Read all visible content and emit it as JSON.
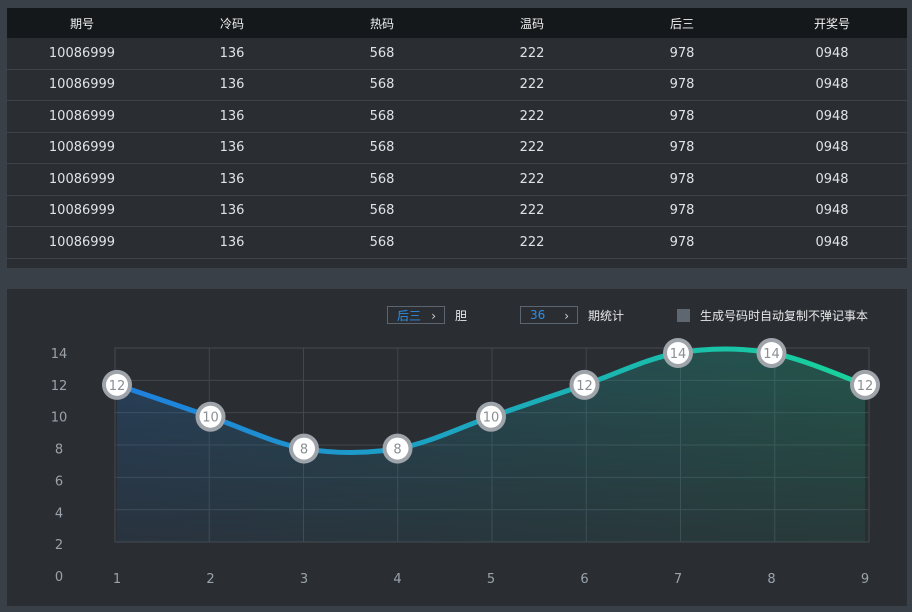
{
  "table": {
    "headers": [
      "期号",
      "冷码",
      "热码",
      "温码",
      "后三",
      "开奖号"
    ],
    "rows": [
      [
        "10086999",
        "136",
        "568",
        "222",
        "978",
        "0948"
      ],
      [
        "10086999",
        "136",
        "568",
        "222",
        "978",
        "0948"
      ],
      [
        "10086999",
        "136",
        "568",
        "222",
        "978",
        "0948"
      ],
      [
        "10086999",
        "136",
        "568",
        "222",
        "978",
        "0948"
      ],
      [
        "10086999",
        "136",
        "568",
        "222",
        "978",
        "0948"
      ],
      [
        "10086999",
        "136",
        "568",
        "222",
        "978",
        "0948"
      ],
      [
        "10086999",
        "136",
        "568",
        "222",
        "978",
        "0948"
      ]
    ]
  },
  "controls": {
    "position_select": "后三",
    "position_label": "胆",
    "period_select": "36",
    "period_label": "期统计",
    "copy_checkbox_label": "生成号码时自动复制不弹记事本",
    "copy_checkbox_checked": false
  },
  "colors": {
    "line_start": "#1f7fe0",
    "line_end": "#18d39a",
    "accent_text": "#2f8ee5"
  },
  "chart_data": {
    "type": "line",
    "x": [
      1,
      2,
      3,
      4,
      5,
      6,
      7,
      8,
      9
    ],
    "y": [
      12,
      10,
      8,
      8,
      10,
      12,
      14,
      14,
      12
    ],
    "point_labels": [
      "12",
      "10",
      "8",
      "8",
      "10",
      "12",
      "14",
      "14",
      "12"
    ],
    "y_ticks": [
      "0",
      "2",
      "4",
      "6",
      "8",
      "10",
      "12",
      "14"
    ],
    "x_ticks": [
      "1",
      "2",
      "3",
      "4",
      "5",
      "6",
      "7",
      "8",
      "9"
    ],
    "ylim": [
      0,
      14
    ],
    "grid": true,
    "smooth": true,
    "area_fill": true
  }
}
